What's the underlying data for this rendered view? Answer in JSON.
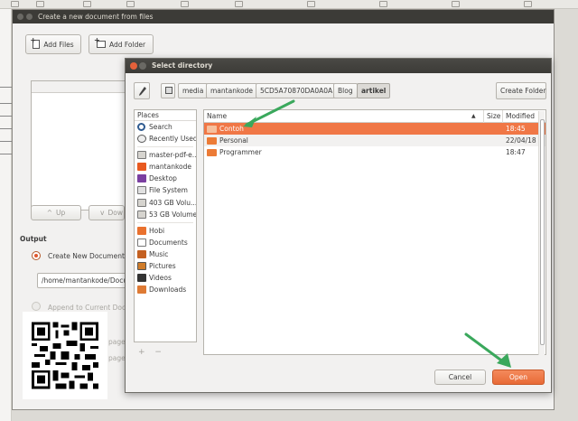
{
  "back_window": {
    "title": "Create a new document from files",
    "add_files": "Add Files",
    "add_folder": "Add Folder",
    "up": "Up",
    "down": "Dow",
    "output_label": "Output",
    "create_new_document": "Create New Document",
    "path_value": "/home/mantankode/Docu",
    "append_to_current": "Append to Current Doc",
    "page_1": "page",
    "page_2": "page"
  },
  "dialog": {
    "title": "Select directory",
    "path_crumbs": [
      "media",
      "mantankode",
      "5CD5A70870DA0A0A",
      "Blog",
      "artikel"
    ],
    "active_crumb_index": 4,
    "create_folder": "Create Folder",
    "places_header": "Places",
    "places": [
      {
        "label": "Search",
        "icon": "search-icon",
        "group": 0
      },
      {
        "label": "Recently Used",
        "icon": "clock-icon",
        "group": 0
      },
      {
        "label": "master-pdf-e...",
        "icon": "drive-icon",
        "group": 1
      },
      {
        "label": "mantankode",
        "icon": "home-icon",
        "group": 1
      },
      {
        "label": "Desktop",
        "icon": "desktop-icon",
        "group": 1
      },
      {
        "label": "File System",
        "icon": "filesystem-icon",
        "group": 1
      },
      {
        "label": "403 GB Volu...",
        "icon": "drive-icon",
        "group": 1
      },
      {
        "label": "53 GB Volume",
        "icon": "drive-icon",
        "group": 1
      },
      {
        "label": "Hobi",
        "icon": "folder-icon",
        "group": 2
      },
      {
        "label": "Documents",
        "icon": "documents-icon",
        "group": 2
      },
      {
        "label": "Music",
        "icon": "music-icon",
        "group": 2
      },
      {
        "label": "Pictures",
        "icon": "pictures-icon",
        "group": 2
      },
      {
        "label": "Videos",
        "icon": "videos-icon",
        "group": 2
      },
      {
        "label": "Downloads",
        "icon": "downloads-icon",
        "group": 2
      }
    ],
    "add_place": "+",
    "remove_place": "−",
    "columns": {
      "name": "Name",
      "size": "Size",
      "modified": "Modified"
    },
    "files": [
      {
        "name": "Contoh",
        "size": "",
        "modified": "18:45",
        "selected": true
      },
      {
        "name": "Personal",
        "size": "",
        "modified": "22/04/18",
        "selected": false
      },
      {
        "name": "Programmer",
        "size": "",
        "modified": "18:47",
        "selected": false
      }
    ],
    "cancel": "Cancel",
    "open": "Open"
  },
  "colors": {
    "selection": "#f07746",
    "accent": "#e86a36",
    "annotation_arrow": "#3aa85c",
    "titlebar": "#3c3b37"
  }
}
